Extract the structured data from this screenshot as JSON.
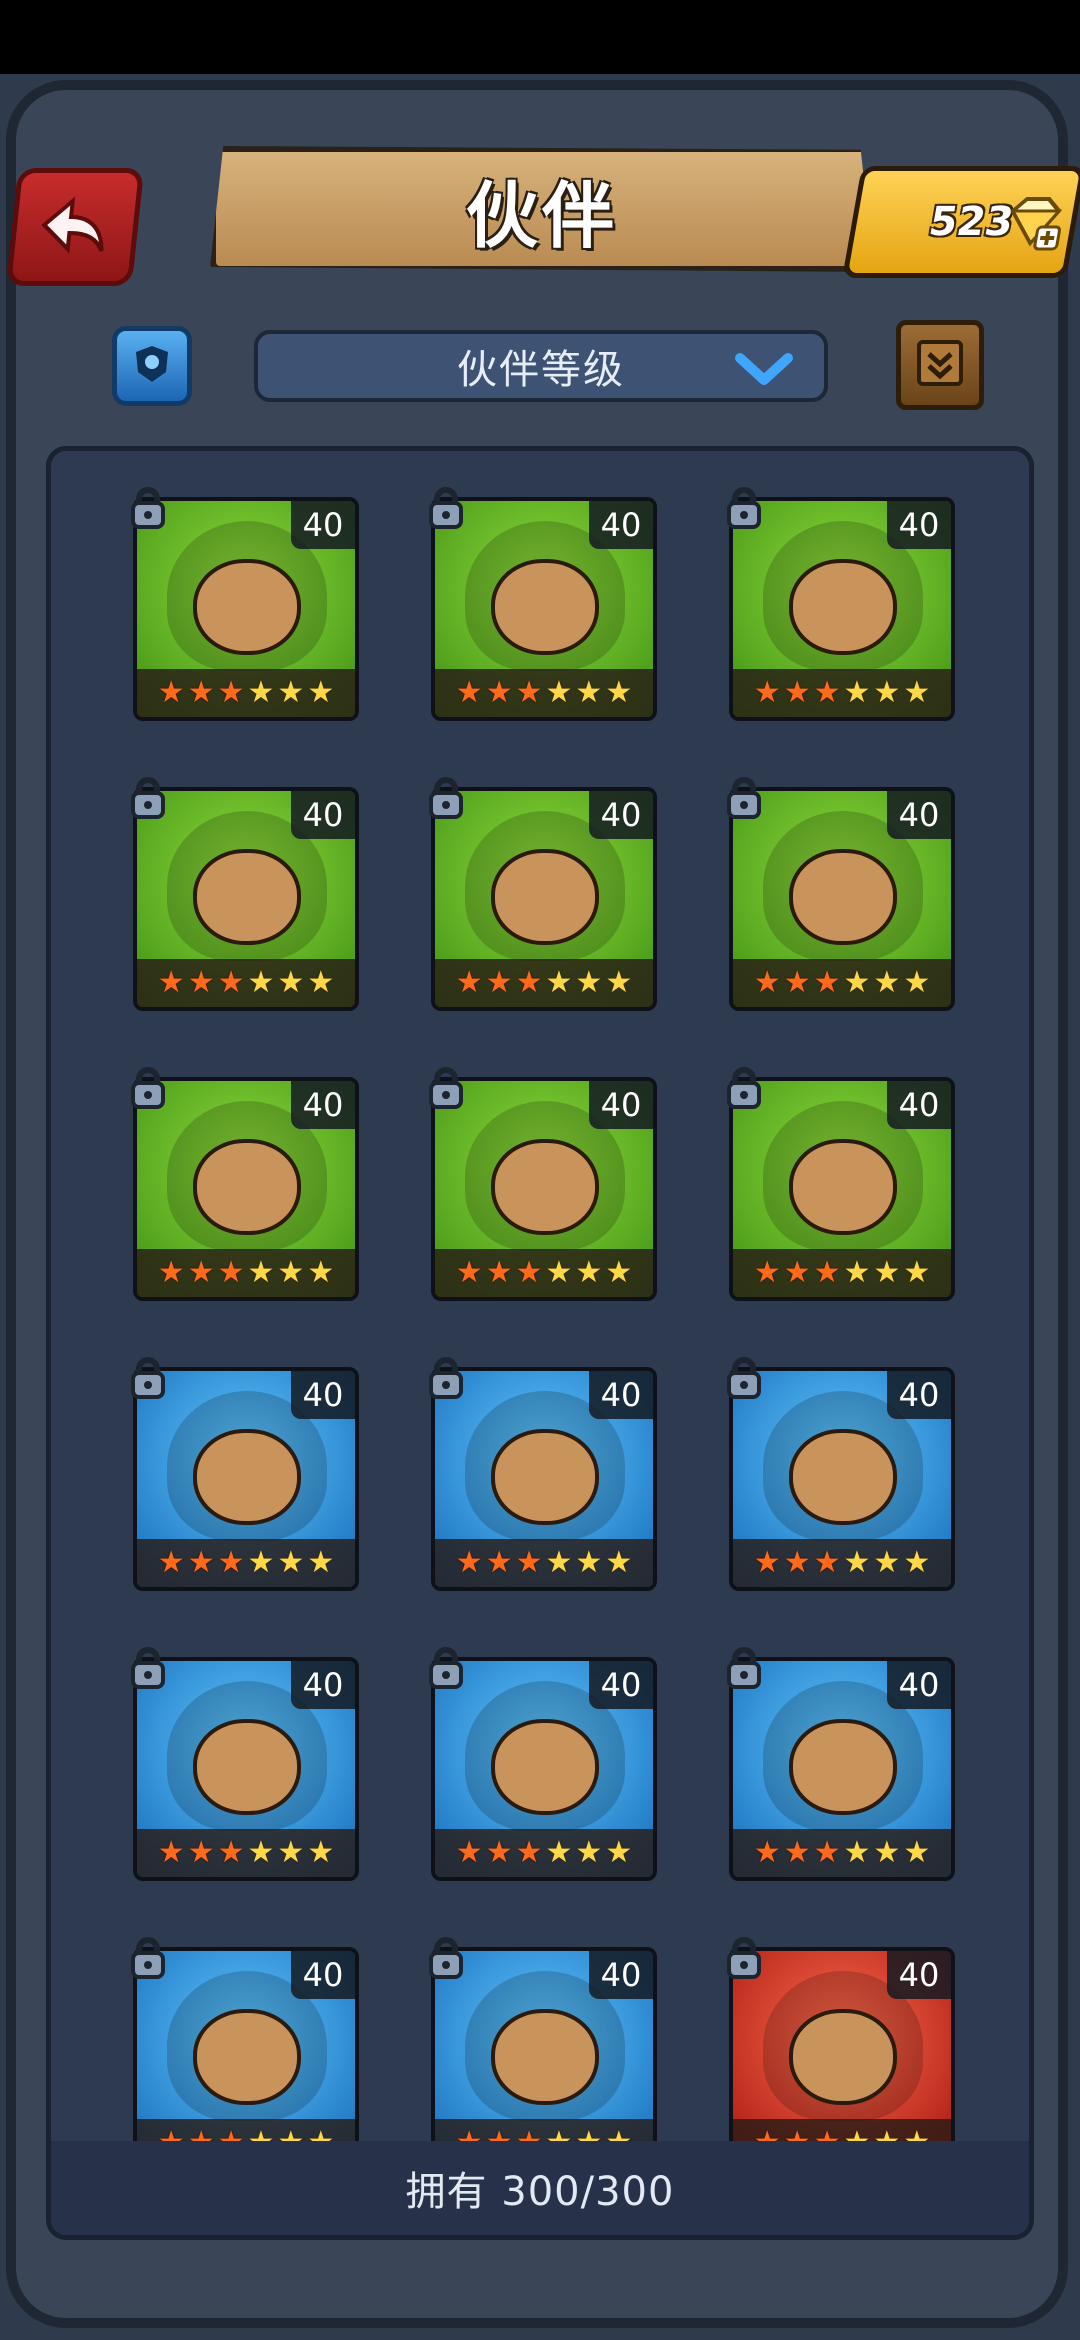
{
  "header": {
    "title": "伙伴",
    "currency": {
      "value": "523",
      "icon": "gem-plus-icon"
    }
  },
  "toolbar": {
    "filter_icon": "shield-filter-icon",
    "sort_label": "伙伴等级",
    "book_icon": "book-icon"
  },
  "partners": [
    {
      "level": "40",
      "stars": 3,
      "max_stars": 6,
      "theme": "green"
    },
    {
      "level": "40",
      "stars": 3,
      "max_stars": 6,
      "theme": "green"
    },
    {
      "level": "40",
      "stars": 3,
      "max_stars": 6,
      "theme": "green"
    },
    {
      "level": "40",
      "stars": 3,
      "max_stars": 6,
      "theme": "green"
    },
    {
      "level": "40",
      "stars": 3,
      "max_stars": 6,
      "theme": "green"
    },
    {
      "level": "40",
      "stars": 3,
      "max_stars": 6,
      "theme": "green"
    },
    {
      "level": "40",
      "stars": 3,
      "max_stars": 6,
      "theme": "green"
    },
    {
      "level": "40",
      "stars": 3,
      "max_stars": 6,
      "theme": "green"
    },
    {
      "level": "40",
      "stars": 3,
      "max_stars": 6,
      "theme": "green"
    },
    {
      "level": "40",
      "stars": 3,
      "max_stars": 6,
      "theme": "blue"
    },
    {
      "level": "40",
      "stars": 3,
      "max_stars": 6,
      "theme": "blue"
    },
    {
      "level": "40",
      "stars": 3,
      "max_stars": 6,
      "theme": "blue"
    },
    {
      "level": "40",
      "stars": 3,
      "max_stars": 6,
      "theme": "blue"
    },
    {
      "level": "40",
      "stars": 3,
      "max_stars": 6,
      "theme": "blue"
    },
    {
      "level": "40",
      "stars": 3,
      "max_stars": 6,
      "theme": "blue"
    },
    {
      "level": "40",
      "stars": 3,
      "max_stars": 6,
      "theme": "blue"
    },
    {
      "level": "40",
      "stars": 3,
      "max_stars": 6,
      "theme": "blue"
    },
    {
      "level": "40",
      "stars": 3,
      "max_stars": 6,
      "theme": "red"
    }
  ],
  "footer": {
    "owned_label": "拥有 300/300"
  },
  "colors": {
    "accent_gold": "#e5a513",
    "back_red": "#c72c2c",
    "panel": "#2e3a4f"
  }
}
